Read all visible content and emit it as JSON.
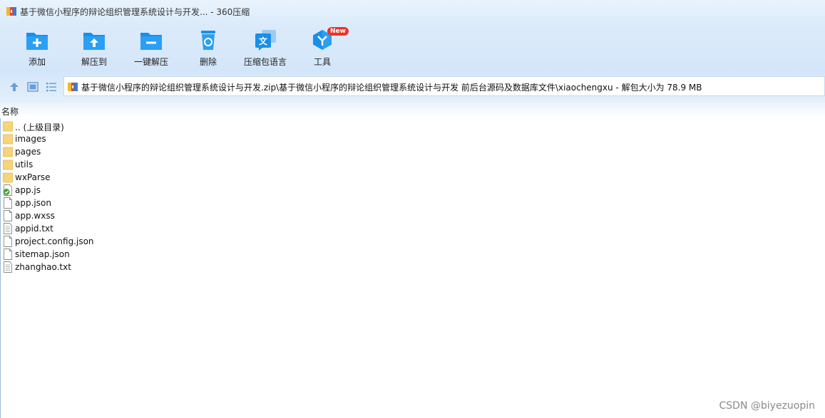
{
  "window": {
    "title": "基于微信小程序的辩论组织管理系统设计与开发... - 360压缩"
  },
  "toolbar": {
    "items": [
      {
        "label": "添加",
        "icon": "add-folder-icon"
      },
      {
        "label": "解压到",
        "icon": "extract-to-icon"
      },
      {
        "label": "一键解压",
        "icon": "one-click-extract-icon"
      },
      {
        "label": "删除",
        "icon": "recycle-bin-icon"
      },
      {
        "label": "压缩包语言",
        "icon": "language-icon"
      },
      {
        "label": "工具",
        "icon": "tools-icon",
        "badge": "New"
      }
    ]
  },
  "address": {
    "path": "基于微信小程序的辩论组织管理系统设计与开发.zip\\基于微信小程序的辩论组织管理系统设计与开发 前后台源码及数据库文件\\xiaochengxu - 解包大小为 78.9 MB"
  },
  "columns": {
    "name": "名称"
  },
  "files": [
    {
      "name": ".. (上级目录)",
      "type": "folder"
    },
    {
      "name": "images",
      "type": "folder"
    },
    {
      "name": "pages",
      "type": "folder"
    },
    {
      "name": "utils",
      "type": "folder"
    },
    {
      "name": "wxParse",
      "type": "folder"
    },
    {
      "name": "app.js",
      "type": "js"
    },
    {
      "name": "app.json",
      "type": "file"
    },
    {
      "name": "app.wxss",
      "type": "file"
    },
    {
      "name": "appid.txt",
      "type": "txt"
    },
    {
      "name": "project.config.json",
      "type": "file"
    },
    {
      "name": "sitemap.json",
      "type": "file"
    },
    {
      "name": "zhanghao.txt",
      "type": "txt"
    }
  ],
  "watermark": "CSDN @biyezuopin",
  "colors": {
    "accent": "#1a8fe8",
    "folder": "#f6d47a",
    "badge": "#e8342a"
  }
}
